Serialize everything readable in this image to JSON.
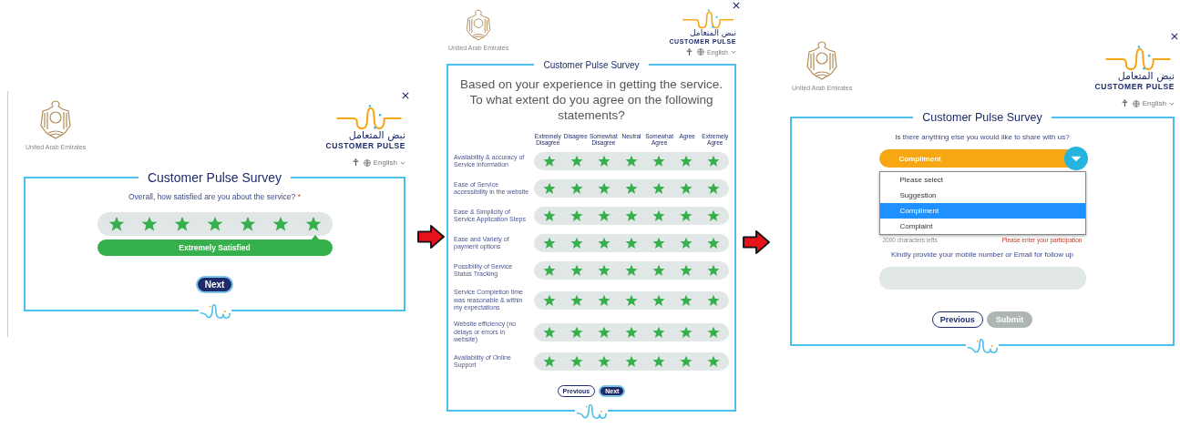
{
  "screens": [
    {
      "kind": "rating",
      "emblem_caption": "United Arab Emirates",
      "logo_arabic": "نبض المتعامل",
      "logo_name": "CUSTOMER PULSE",
      "language": "English",
      "title": "Customer Pulse Survey",
      "question": "Overall, how satisfied are you about the service?",
      "required_mark": "*",
      "stars": 7,
      "rating_label": "Extremely Satisfied",
      "buttons": [
        {
          "label": "Next",
          "kind": "primary",
          "disabled": false
        }
      ]
    },
    {
      "kind": "matrix",
      "emblem_caption": "United Arab Emirates",
      "logo_arabic": "نبض المتعامل",
      "logo_name": "CUSTOMER PULSE",
      "language": "English",
      "title": "Customer Pulse Survey",
      "question": "Based on your experience in getting the service. To what extent do you agree on the following statements?",
      "columns": [
        "Extremely Disagree",
        "Disagree",
        "Somewhat Disagree",
        "Neutral",
        "Somewhat Agree",
        "Agree",
        "Extremely Agree"
      ],
      "rows": [
        {
          "label": "Availability & accuracy of Service information",
          "stars": 7
        },
        {
          "label": "Ease of Service accessibility in the website",
          "stars": 7
        },
        {
          "label": "Ease & Simplicity of Service Application Steps",
          "stars": 7
        },
        {
          "label": "Ease and Variety of payment options",
          "stars": 7
        },
        {
          "label": "Possibility of Service Status Tracking",
          "stars": 7
        },
        {
          "label": "Service Completion time was reasonable & within my expectations",
          "stars": 7
        },
        {
          "label": "Website efficiency (no delays or errors in website)",
          "stars": 7
        },
        {
          "label": "Availability of Online Support",
          "stars": 7
        }
      ],
      "buttons": [
        {
          "label": "Previous",
          "kind": "secondary",
          "disabled": false
        },
        {
          "label": "Next",
          "kind": "primary",
          "disabled": false
        }
      ]
    },
    {
      "kind": "comment",
      "emblem_caption": "United Arab Emirates",
      "logo_arabic": "نبض المتعامل",
      "logo_name": "CUSTOMER PULSE",
      "language": "English",
      "title": "Customer Pulse Survey",
      "question": "Is there anything else you would like to share with us?",
      "dropdown": {
        "value": "Compliment",
        "expanded": true,
        "options": [
          {
            "label": "Please select",
            "selected": false
          },
          {
            "label": "Suggestion",
            "selected": false
          },
          {
            "label": "Compliment",
            "selected": true
          },
          {
            "label": "Complaint",
            "selected": false
          }
        ]
      },
      "char_count": "2000 characters lefts",
      "error": "Please enter your participation",
      "contact_label": "Kindly provide your mobile number or Email for follow up",
      "buttons": [
        {
          "label": "Previous",
          "kind": "secondary",
          "disabled": false
        },
        {
          "label": "Submit",
          "kind": "primary",
          "disabled": true
        }
      ]
    }
  ]
}
